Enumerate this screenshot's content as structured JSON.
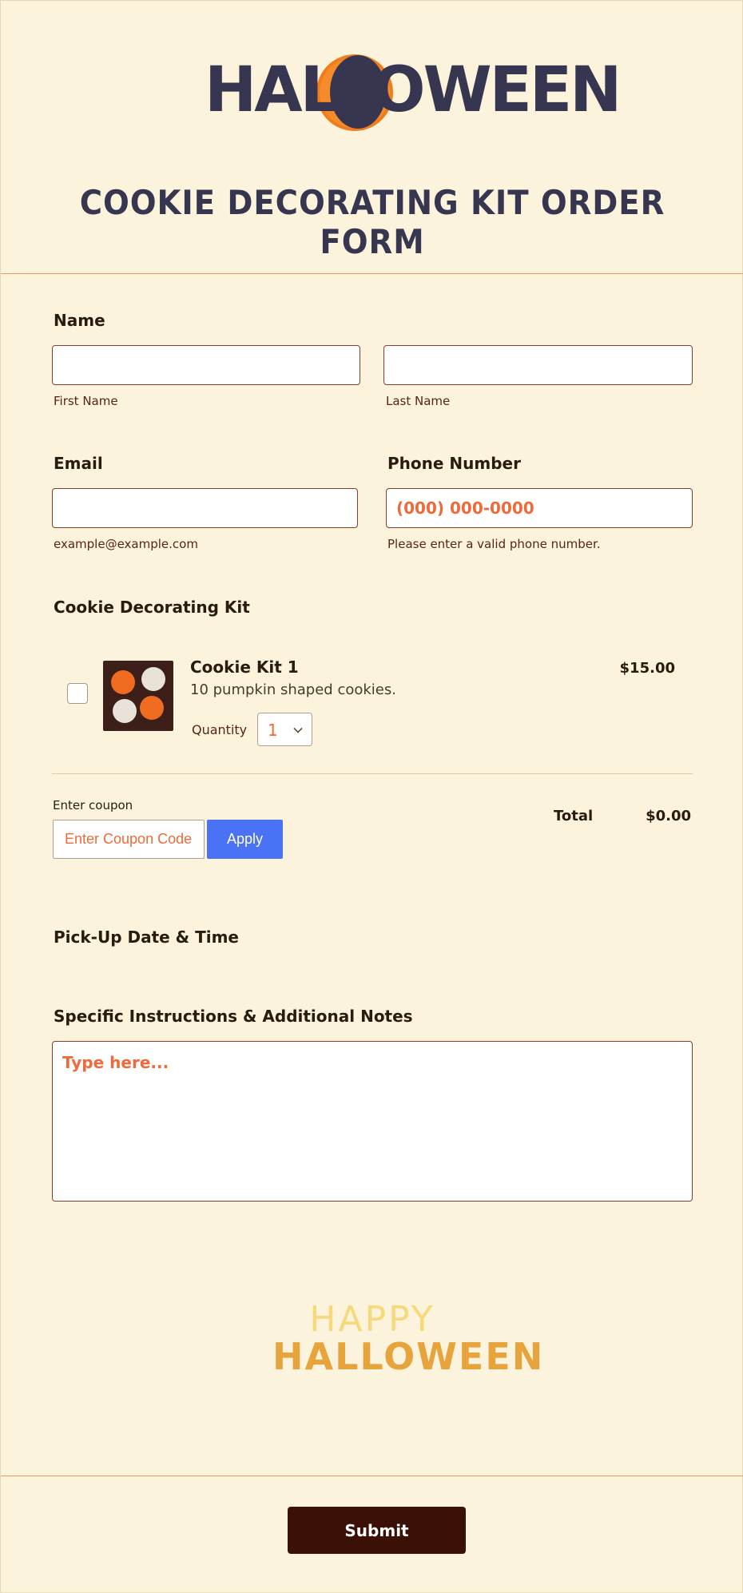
{
  "header": {
    "logo_text": "HALLOWEEN",
    "title": "COOKIE DECORATING KIT ORDER FORM"
  },
  "name": {
    "label": "Name",
    "first_sublabel": "First Name",
    "last_sublabel": "Last Name",
    "first_value": "",
    "last_value": ""
  },
  "email": {
    "label": "Email",
    "sublabel": "example@example.com",
    "value": ""
  },
  "phone": {
    "label": "Phone Number",
    "placeholder": "(000) 000-0000",
    "sublabel": "Please enter a valid phone number."
  },
  "kit": {
    "label": "Cookie Decorating Kit",
    "product": {
      "name": "Cookie Kit 1",
      "description": "10 pumpkin shaped cookies.",
      "price": "$15.00",
      "quantity_label": "Quantity",
      "quantity": "1",
      "checked": false
    },
    "coupon_label": "Enter coupon",
    "coupon_placeholder": "Enter Coupon Code",
    "apply_label": "Apply",
    "total_label": "Total",
    "total_value": "$0.00"
  },
  "pickup": {
    "label": "Pick-Up Date & Time"
  },
  "notes": {
    "label": "Specific Instructions & Additional Notes",
    "placeholder": "Type here..."
  },
  "footer_graphic": {
    "line1": "HAPPY",
    "line2": "HALLOWEEN"
  },
  "submit_label": "Submit",
  "colors": {
    "background": "#fbf3dc",
    "accent_orange": "#ee6a3a",
    "border_brown": "#8a3c28",
    "apply_blue": "#4a72f5",
    "submit_dark": "#3b1007",
    "title_navy": "#373650"
  }
}
